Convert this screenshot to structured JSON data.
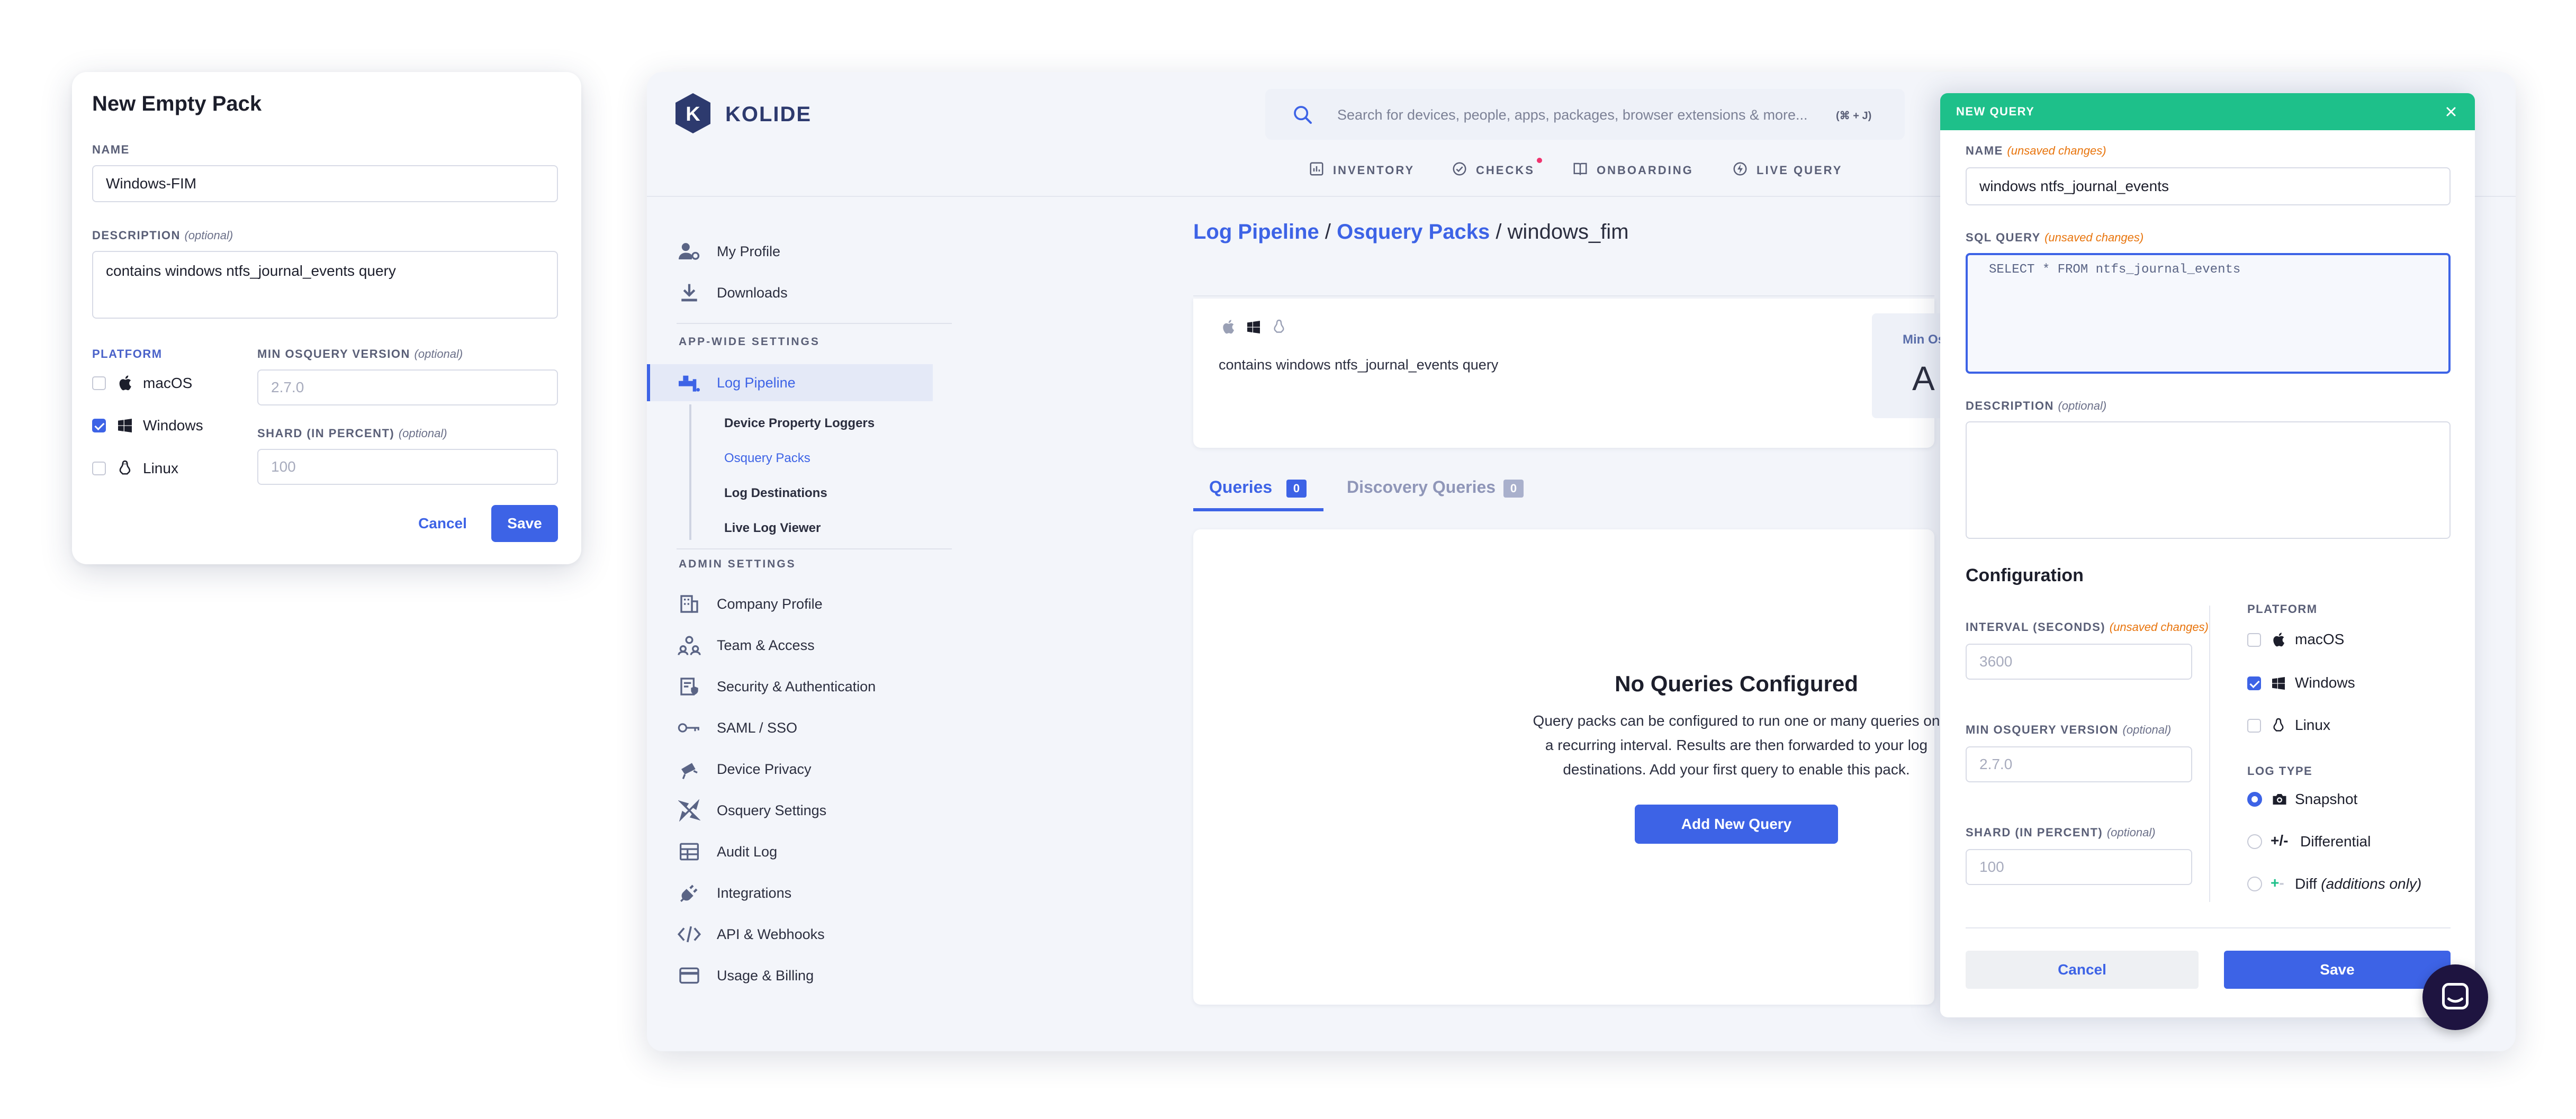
{
  "pack_modal": {
    "title": "New Empty Pack",
    "name_label": "NAME",
    "name_value": "Windows-FIM",
    "description_label": "DESCRIPTION",
    "optional": "(optional)",
    "description_value": "contains windows ntfs_journal_events query",
    "platform_label": "PLATFORM",
    "platforms": [
      "macOS",
      "Windows",
      "Linux"
    ],
    "platforms_checked": [
      false,
      true,
      false
    ],
    "min_version_label": "MIN OSQUERY VERSION",
    "min_version_placeholder": "2.7.0",
    "shard_label": "SHARD (IN PERCENT)",
    "shard_placeholder": "100",
    "cancel": "Cancel",
    "save": "Save"
  },
  "app": {
    "logo_text": "KOLIDE",
    "search_placeholder": "Search for devices, people, apps, packages, browser extensions & more...",
    "search_shortcut": "(⌘ + J)",
    "nav": [
      "INVENTORY",
      "CHECKS",
      "ONBOARDING",
      "LIVE QUERY"
    ],
    "sidebar": {
      "top": [
        "My Profile",
        "Downloads"
      ],
      "app_wide_heading": "APP-WIDE SETTINGS",
      "log_pipeline": "Log Pipeline",
      "sub": [
        "Device Property Loggers",
        "Osquery Packs",
        "Log Destinations",
        "Live Log Viewer"
      ],
      "admin_heading": "ADMIN SETTINGS",
      "admin": [
        "Company Profile",
        "Team & Access",
        "Security & Authentication",
        "SAML / SSO",
        "Device Privacy",
        "Osquery Settings",
        "Audit Log",
        "Integrations",
        "API & Webhooks",
        "Usage & Billing"
      ]
    },
    "breadcrumb": {
      "part1": "Log Pipeline",
      "sep": " / ",
      "part2": "Osquery Packs",
      "current": "windows_fim"
    },
    "pack_description": "contains windows ntfs_journal_events query",
    "min_osquery_partial": "Min Osqu",
    "min_osquery_value_partial": "A",
    "tabs": [
      {
        "label": "Queries",
        "count": "0"
      },
      {
        "label": "Discovery Queries",
        "count": "0"
      }
    ],
    "empty": {
      "title": "No Queries Configured",
      "line1": "Query packs can be configured to run one or many queries on",
      "line2": "a recurring interval. Results are then forwarded to your log",
      "line3": "destinations. Add your first query to enable this pack.",
      "button": "Add New Query"
    }
  },
  "query_panel": {
    "header": "NEW QUERY",
    "name_label": "NAME",
    "unsaved": "(unsaved changes)",
    "name_value": "windows ntfs_journal_events",
    "sql_label": "SQL QUERY",
    "sql_value": "SELECT * FROM ntfs_journal_events",
    "description_label": "DESCRIPTION",
    "optional": "(optional)",
    "configuration": "Configuration",
    "interval_label": "INTERVAL (SECONDS)",
    "interval_placeholder": "3600",
    "min_version_label": "MIN OSQUERY VERSION",
    "min_version_placeholder": "2.7.0",
    "shard_label": "SHARD (IN PERCENT)",
    "shard_placeholder": "100",
    "platform_label": "PLATFORM",
    "platforms": [
      "macOS",
      "Windows",
      "Linux"
    ],
    "platforms_checked": [
      false,
      true,
      false
    ],
    "log_type_label": "LOG TYPE",
    "log_types": [
      "Snapshot",
      "Differential",
      "Diff"
    ],
    "diff_suffix": "(additions only)",
    "log_type_selected": 0,
    "cancel": "Cancel",
    "save": "Save"
  },
  "colors": {
    "accent": "#3d63e6",
    "header_green": "#1ec08a",
    "warning": "#e8740c",
    "chat_bubble": "#1e1440"
  }
}
